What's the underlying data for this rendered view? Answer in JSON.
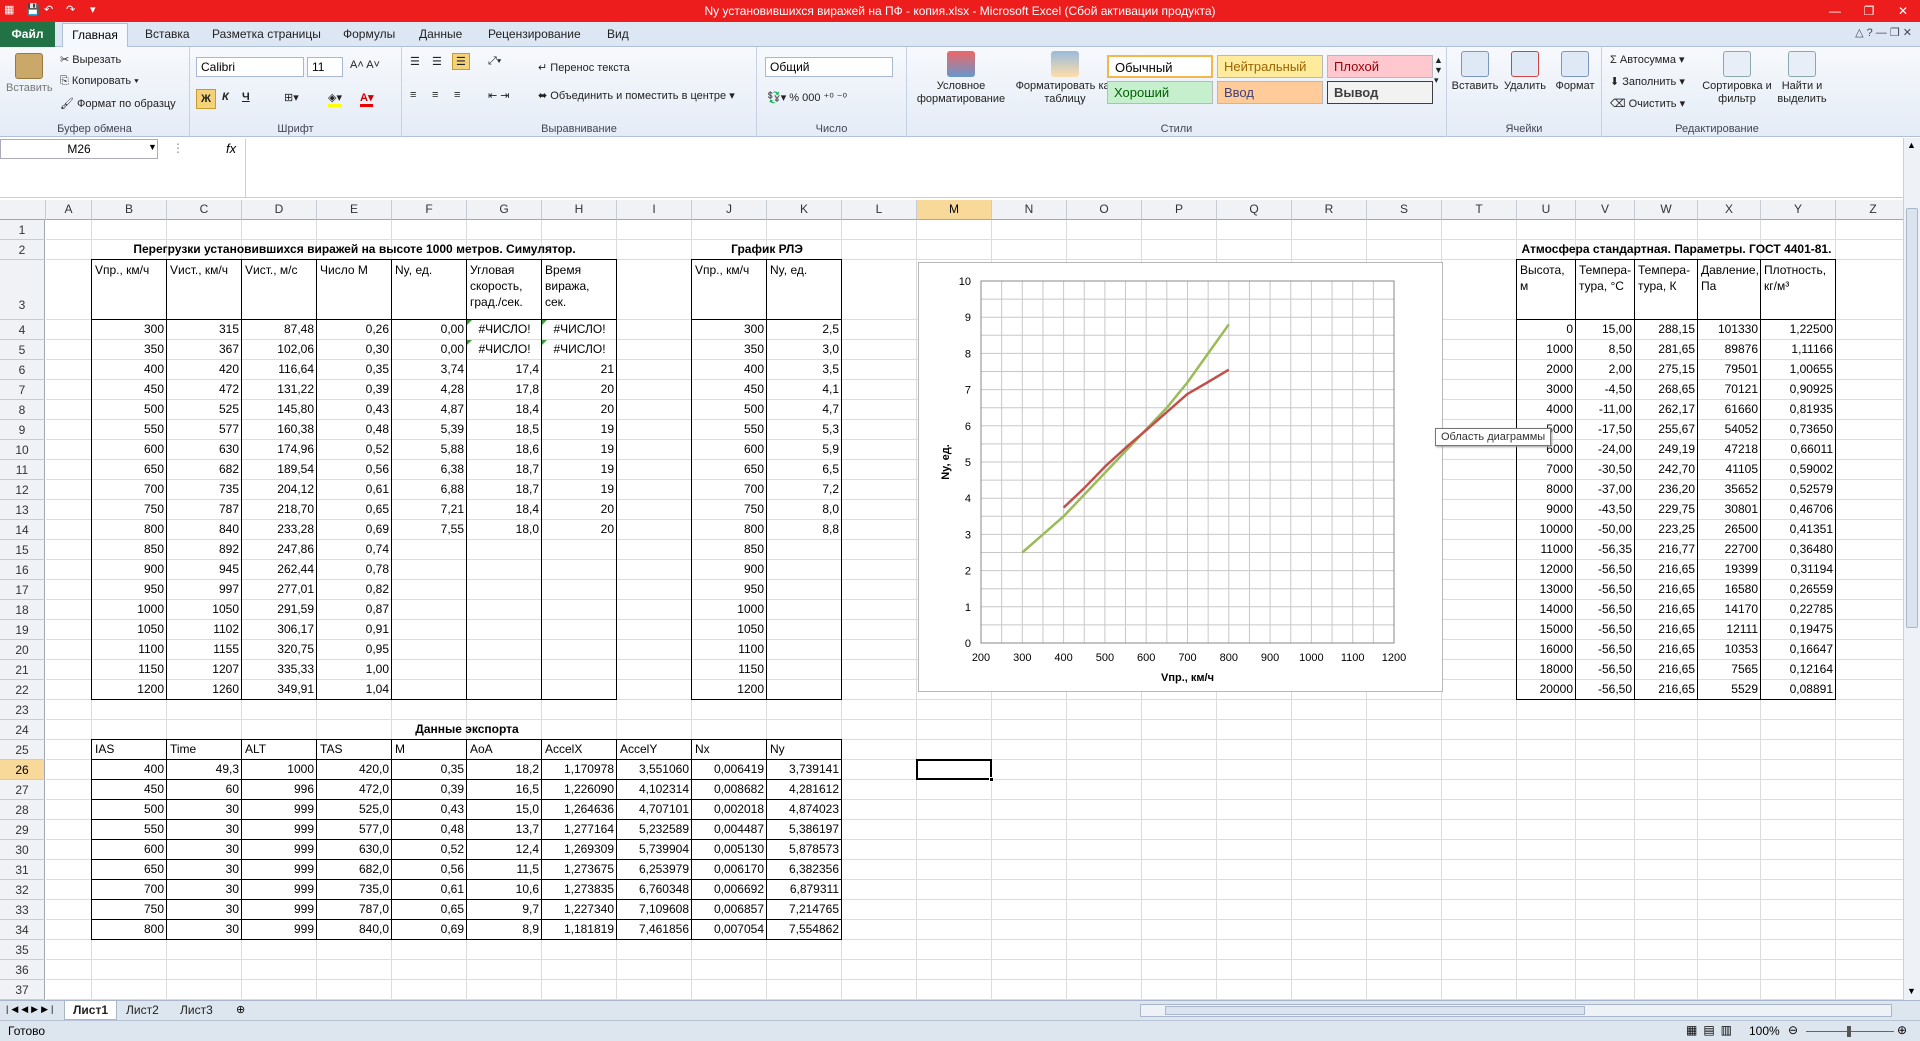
{
  "window": {
    "title": "Ny установившихся виражей на ПФ - копия.xlsx  -  Microsoft Excel (Сбой активации продукта)"
  },
  "tabs": {
    "file": "Файл",
    "home": "Главная",
    "items": [
      "Вставка",
      "Разметка страницы",
      "Формулы",
      "Данные",
      "Рецензирование",
      "Вид"
    ]
  },
  "ribbon": {
    "clipboard": {
      "paste": "Вставить",
      "cut": "Вырезать",
      "copy": "Копировать",
      "format_painter": "Формат по образцу",
      "label": "Буфер обмена"
    },
    "font": {
      "name": "Calibri",
      "size": "11",
      "bold": "Ж",
      "italic": "К",
      "underline": "Ч",
      "label": "Шрифт"
    },
    "alignment": {
      "wrap": "Перенос текста",
      "merge": "Объединить и поместить в центре",
      "label": "Выравнивание"
    },
    "number": {
      "format": "Общий",
      "label": "Число"
    },
    "styles": {
      "conditional": "Условное форматирование",
      "as_table": "Форматировать как таблицу",
      "cells": [
        "Обычный",
        "Нейтральный",
        "Плохой",
        "Хороший",
        "Ввод",
        "Вывод"
      ],
      "label": "Стили"
    },
    "cells": {
      "insert": "Вставить",
      "delete": "Удалить",
      "format": "Формат",
      "label": "Ячейки"
    },
    "editing": {
      "autosum": "Автосумма",
      "fill": "Заполнить",
      "clear": "Очистить",
      "sort": "Сортировка и фильтр",
      "find": "Найти и выделить",
      "label": "Редактирование"
    }
  },
  "formula_bar": {
    "name_box": "M26",
    "fx": "fx",
    "value": ""
  },
  "columns": [
    "A",
    "B",
    "C",
    "D",
    "E",
    "F",
    "G",
    "H",
    "I",
    "J",
    "K",
    "L",
    "M",
    "N",
    "O",
    "P",
    "Q",
    "R",
    "S",
    "T",
    "U",
    "V",
    "W",
    "X",
    "Y",
    "Z"
  ],
  "selected_column": "M",
  "selected_row": 26,
  "rows": [
    "1",
    "2",
    "3",
    "4",
    "5",
    "6",
    "7",
    "8",
    "9",
    "10",
    "11",
    "12",
    "13",
    "14",
    "15",
    "16",
    "17",
    "18",
    "19",
    "20",
    "21",
    "22",
    "23",
    "24",
    "25",
    "26",
    "27",
    "28",
    "29",
    "30",
    "31",
    "32",
    "33",
    "34",
    "35",
    "36",
    "37"
  ],
  "table1": {
    "title": "Перегрузки установившихся виражей на высоте 1000 метров. Симулятор.",
    "headers": [
      "Vпр., км/ч",
      "Vист., км/ч",
      "Vист., м/с",
      "Число М",
      "Ny, ед.",
      "Угловая скорость, град./сек.",
      "Время виража, сек."
    ],
    "rows": [
      [
        "300",
        "315",
        "87,48",
        "0,26",
        "0,00",
        "#ЧИСЛО!",
        "#ЧИСЛО!"
      ],
      [
        "350",
        "367",
        "102,06",
        "0,30",
        "0,00",
        "#ЧИСЛО!",
        "#ЧИСЛО!"
      ],
      [
        "400",
        "420",
        "116,64",
        "0,35",
        "3,74",
        "17,4",
        "21"
      ],
      [
        "450",
        "472",
        "131,22",
        "0,39",
        "4,28",
        "17,8",
        "20"
      ],
      [
        "500",
        "525",
        "145,80",
        "0,43",
        "4,87",
        "18,4",
        "20"
      ],
      [
        "550",
        "577",
        "160,38",
        "0,48",
        "5,39",
        "18,5",
        "19"
      ],
      [
        "600",
        "630",
        "174,96",
        "0,52",
        "5,88",
        "18,6",
        "19"
      ],
      [
        "650",
        "682",
        "189,54",
        "0,56",
        "6,38",
        "18,7",
        "19"
      ],
      [
        "700",
        "735",
        "204,12",
        "0,61",
        "6,88",
        "18,7",
        "19"
      ],
      [
        "750",
        "787",
        "218,70",
        "0,65",
        "7,21",
        "18,4",
        "20"
      ],
      [
        "800",
        "840",
        "233,28",
        "0,69",
        "7,55",
        "18,0",
        "20"
      ],
      [
        "850",
        "892",
        "247,86",
        "0,74",
        "",
        "",
        ""
      ],
      [
        "900",
        "945",
        "262,44",
        "0,78",
        "",
        "",
        ""
      ],
      [
        "950",
        "997",
        "277,01",
        "0,82",
        "",
        "",
        ""
      ],
      [
        "1000",
        "1050",
        "291,59",
        "0,87",
        "",
        "",
        ""
      ],
      [
        "1050",
        "1102",
        "306,17",
        "0,91",
        "",
        "",
        ""
      ],
      [
        "1100",
        "1155",
        "320,75",
        "0,95",
        "",
        "",
        ""
      ],
      [
        "1150",
        "1207",
        "335,33",
        "1,00",
        "",
        "",
        ""
      ],
      [
        "1200",
        "1260",
        "349,91",
        "1,04",
        "",
        "",
        ""
      ]
    ]
  },
  "table2": {
    "title": "График РЛЭ",
    "headers": [
      "Vпр., км/ч",
      "Ny, ед."
    ],
    "rows": [
      [
        "300",
        "2,5"
      ],
      [
        "350",
        "3,0"
      ],
      [
        "400",
        "3,5"
      ],
      [
        "450",
        "4,1"
      ],
      [
        "500",
        "4,7"
      ],
      [
        "550",
        "5,3"
      ],
      [
        "600",
        "5,9"
      ],
      [
        "650",
        "6,5"
      ],
      [
        "700",
        "7,2"
      ],
      [
        "750",
        "8,0"
      ],
      [
        "800",
        "8,8"
      ],
      [
        "850",
        ""
      ],
      [
        "900",
        ""
      ],
      [
        "950",
        ""
      ],
      [
        "1000",
        ""
      ],
      [
        "1050",
        ""
      ],
      [
        "1100",
        ""
      ],
      [
        "1150",
        ""
      ],
      [
        "1200",
        ""
      ]
    ]
  },
  "table3": {
    "title": "Атмосфера стандартная. Параметры. ГОСТ 4401-81.",
    "headers": [
      "Высота, м",
      "Темпера-тура, °С",
      "Темпера-тура, К",
      "Давление, Па",
      "Плотность, кг/м³"
    ],
    "rows": [
      [
        "0",
        "15,00",
        "288,15",
        "101330",
        "1,22500"
      ],
      [
        "1000",
        "8,50",
        "281,65",
        "89876",
        "1,11166"
      ],
      [
        "2000",
        "2,00",
        "275,15",
        "79501",
        "1,00655"
      ],
      [
        "3000",
        "-4,50",
        "268,65",
        "70121",
        "0,90925"
      ],
      [
        "4000",
        "-11,00",
        "262,17",
        "61660",
        "0,81935"
      ],
      [
        "5000",
        "-17,50",
        "255,67",
        "54052",
        "0,73650"
      ],
      [
        "6000",
        "-24,00",
        "249,19",
        "47218",
        "0,66011"
      ],
      [
        "7000",
        "-30,50",
        "242,70",
        "41105",
        "0,59002"
      ],
      [
        "8000",
        "-37,00",
        "236,20",
        "35652",
        "0,52579"
      ],
      [
        "9000",
        "-43,50",
        "229,75",
        "30801",
        "0,46706"
      ],
      [
        "10000",
        "-50,00",
        "223,25",
        "26500",
        "0,41351"
      ],
      [
        "11000",
        "-56,35",
        "216,77",
        "22700",
        "0,36480"
      ],
      [
        "12000",
        "-56,50",
        "216,65",
        "19399",
        "0,31194"
      ],
      [
        "13000",
        "-56,50",
        "216,65",
        "16580",
        "0,26559"
      ],
      [
        "14000",
        "-56,50",
        "216,65",
        "14170",
        "0,22785"
      ],
      [
        "15000",
        "-56,50",
        "216,65",
        "12111",
        "0,19475"
      ],
      [
        "16000",
        "-56,50",
        "216,65",
        "10353",
        "0,16647"
      ],
      [
        "18000",
        "-56,50",
        "216,65",
        "7565",
        "0,12164"
      ],
      [
        "20000",
        "-56,50",
        "216,65",
        "5529",
        "0,08891"
      ]
    ]
  },
  "table4": {
    "title": "Данные экспорта",
    "headers": [
      "IAS",
      "Time",
      "ALT",
      "TAS",
      "M",
      "AoA",
      "AccelX",
      "AccelY",
      "Nx",
      "Ny"
    ],
    "rows": [
      [
        "400",
        "49,3",
        "1000",
        "420,0",
        "0,35",
        "18,2",
        "1,170978",
        "3,551060",
        "0,006419",
        "3,739141"
      ],
      [
        "450",
        "60",
        "996",
        "472,0",
        "0,39",
        "16,5",
        "1,226090",
        "4,102314",
        "0,008682",
        "4,281612"
      ],
      [
        "500",
        "30",
        "999",
        "525,0",
        "0,43",
        "15,0",
        "1,264636",
        "4,707101",
        "0,002018",
        "4,874023"
      ],
      [
        "550",
        "30",
        "999",
        "577,0",
        "0,48",
        "13,7",
        "1,277164",
        "5,232589",
        "0,004487",
        "5,386197"
      ],
      [
        "600",
        "30",
        "999",
        "630,0",
        "0,52",
        "12,4",
        "1,269309",
        "5,739904",
        "0,005130",
        "5,878573"
      ],
      [
        "650",
        "30",
        "999",
        "682,0",
        "0,56",
        "11,5",
        "1,273675",
        "6,253979",
        "0,006170",
        "6,382356"
      ],
      [
        "700",
        "30",
        "999",
        "735,0",
        "0,61",
        "10,6",
        "1,273835",
        "6,760348",
        "0,006692",
        "6,879311"
      ],
      [
        "750",
        "30",
        "999",
        "787,0",
        "0,65",
        "9,7",
        "1,227340",
        "7,109608",
        "0,006857",
        "7,214765"
      ],
      [
        "800",
        "30",
        "999",
        "840,0",
        "0,69",
        "8,9",
        "1,181819",
        "7,461856",
        "0,007054",
        "7,554862"
      ]
    ]
  },
  "chart_data": {
    "type": "line",
    "title": "",
    "xlabel": "Vпр., км/ч",
    "ylabel": "Ny, ед.",
    "xlim": [
      200,
      1200
    ],
    "ylim": [
      0,
      10
    ],
    "xticks": [
      "200",
      "300",
      "400",
      "500",
      "600",
      "700",
      "800",
      "900",
      "1000",
      "1100",
      "1200"
    ],
    "yticks": [
      "0",
      "1",
      "2",
      "3",
      "4",
      "5",
      "6",
      "7",
      "8",
      "9",
      "10"
    ],
    "grid": true,
    "series": [
      {
        "color": "#9bbb59",
        "x": [
          300,
          350,
          400,
          450,
          500,
          550,
          600,
          650,
          700,
          750,
          800
        ],
        "y": [
          2.5,
          3.0,
          3.5,
          4.1,
          4.7,
          5.3,
          5.9,
          6.5,
          7.2,
          8.0,
          8.8
        ]
      },
      {
        "color": "#c0504d",
        "x": [
          400,
          450,
          500,
          550,
          600,
          650,
          700,
          750,
          800
        ],
        "y": [
          3.74,
          4.28,
          4.87,
          5.39,
          5.88,
          6.38,
          6.88,
          7.21,
          7.55
        ]
      }
    ]
  },
  "chart_tooltip": "Область диаграммы",
  "sheets": [
    "Лист1",
    "Лист2",
    "Лист3"
  ],
  "status": {
    "ready": "Готово",
    "zoom": "100%"
  }
}
